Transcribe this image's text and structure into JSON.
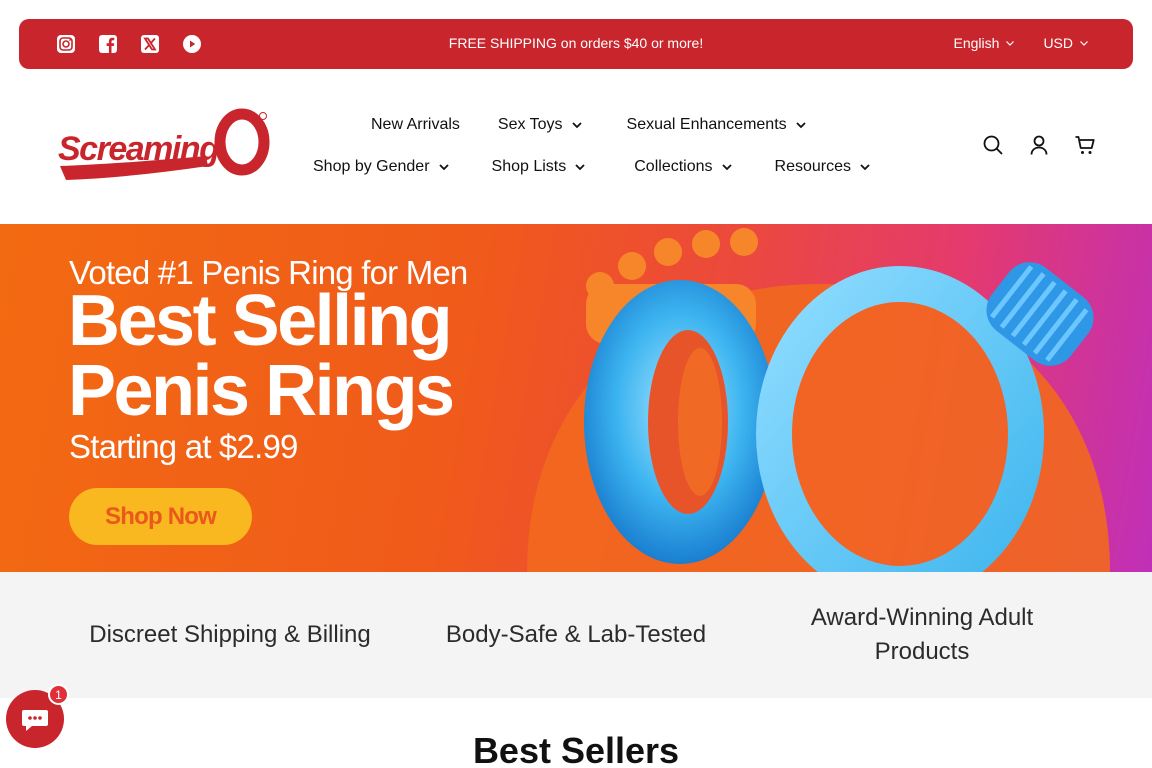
{
  "announcement": {
    "text": "FREE SHIPPING on orders $40 or more!",
    "social": [
      "instagram-icon",
      "facebook-icon",
      "x-twitter-icon",
      "youtube-icon"
    ],
    "language": "English",
    "currency": "USD",
    "bg_color": "#c9252c"
  },
  "header": {
    "logo_text": "Screaming O",
    "nav_row1": [
      {
        "label": "New Arrivals",
        "dropdown": false
      },
      {
        "label": "Sex Toys",
        "dropdown": true
      },
      {
        "label": "Sexual Enhancements",
        "dropdown": true
      }
    ],
    "nav_row2": [
      {
        "label": "Shop by Gender",
        "dropdown": true
      },
      {
        "label": "Shop Lists",
        "dropdown": true
      },
      {
        "label": "Collections",
        "dropdown": true
      },
      {
        "label": "Resources",
        "dropdown": true
      }
    ],
    "icons": [
      "search-icon",
      "account-icon",
      "cart-icon"
    ]
  },
  "hero": {
    "subtitle": "Voted #1 Penis Ring for Men",
    "title_line1": "Best Selling",
    "title_line2": "Penis Rings",
    "price_text": "Starting at $2.99",
    "button_label": "Shop Now",
    "button_color": "#f9b820",
    "button_text_color": "#e9591b"
  },
  "features": [
    "Discreet Shipping & Billing",
    "Body-Safe & Lab-Tested",
    "Award-Winning Adult Products"
  ],
  "section_title": "Best Sellers",
  "chat": {
    "badge": "1"
  }
}
